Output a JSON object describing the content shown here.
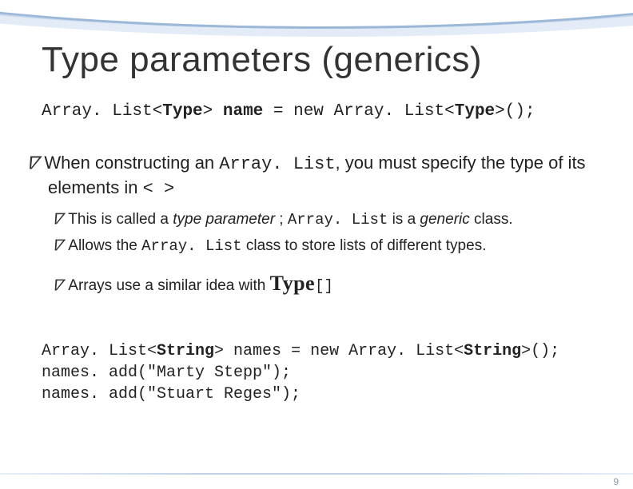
{
  "title": "Type parameters (generics)",
  "syntax": {
    "p1": "Array. List<",
    "type1": "Type",
    "p2": ">",
    "name": " name",
    "p3": " = new Array. List<",
    "type2": "Type",
    "p4": ">();"
  },
  "bullets": {
    "l1": {
      "a": "When constructing an ",
      "code": "Array. List",
      "b": ", you must specify the type of its elements in ",
      "angles": "< >"
    },
    "sub1": {
      "a": "This is called a ",
      "tp": "type parameter",
      "b": " ; ",
      "code": "Array. List",
      "c": " is a ",
      "gen": "generic",
      "d": " class."
    },
    "sub2": {
      "a": "Allows the ",
      "code": "Array. List",
      "b": " class to store lists of different types."
    },
    "sub3": {
      "a": "Arrays use a similar idea with ",
      "big": "Type",
      "code": "[]"
    }
  },
  "code": {
    "l1a": "Array. List<",
    "l1b": "String",
    "l1c": "> names = new Array. List<",
    "l1d": "String",
    "l1e": ">();",
    "l2": "names. add(\"Marty Stepp\");",
    "l3": "names. add(\"Stuart Reges\");"
  },
  "pagenum": "9"
}
